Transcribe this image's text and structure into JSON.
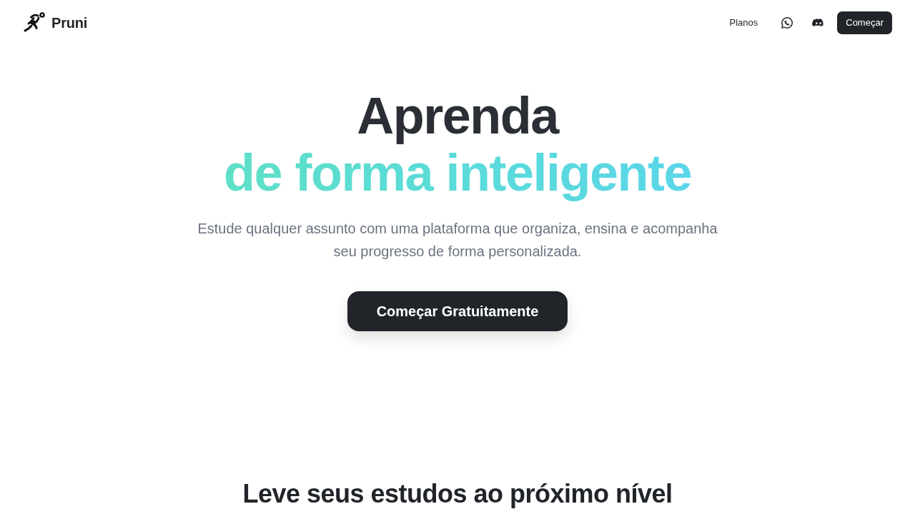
{
  "navbar": {
    "brand": "Pruni",
    "plans_link": "Planos",
    "cta_button": "Começar"
  },
  "hero": {
    "title_line_1": "Aprenda",
    "title_line_2": "de forma inteligente",
    "subtitle": "Estude qualquer assunto com uma plataforma que organiza, ensina e acompanha seu progresso de forma personalizada.",
    "cta_button": "Começar Gratuitamente"
  },
  "features_section": {
    "heading": "Leve seus estudos ao próximo nível"
  }
}
